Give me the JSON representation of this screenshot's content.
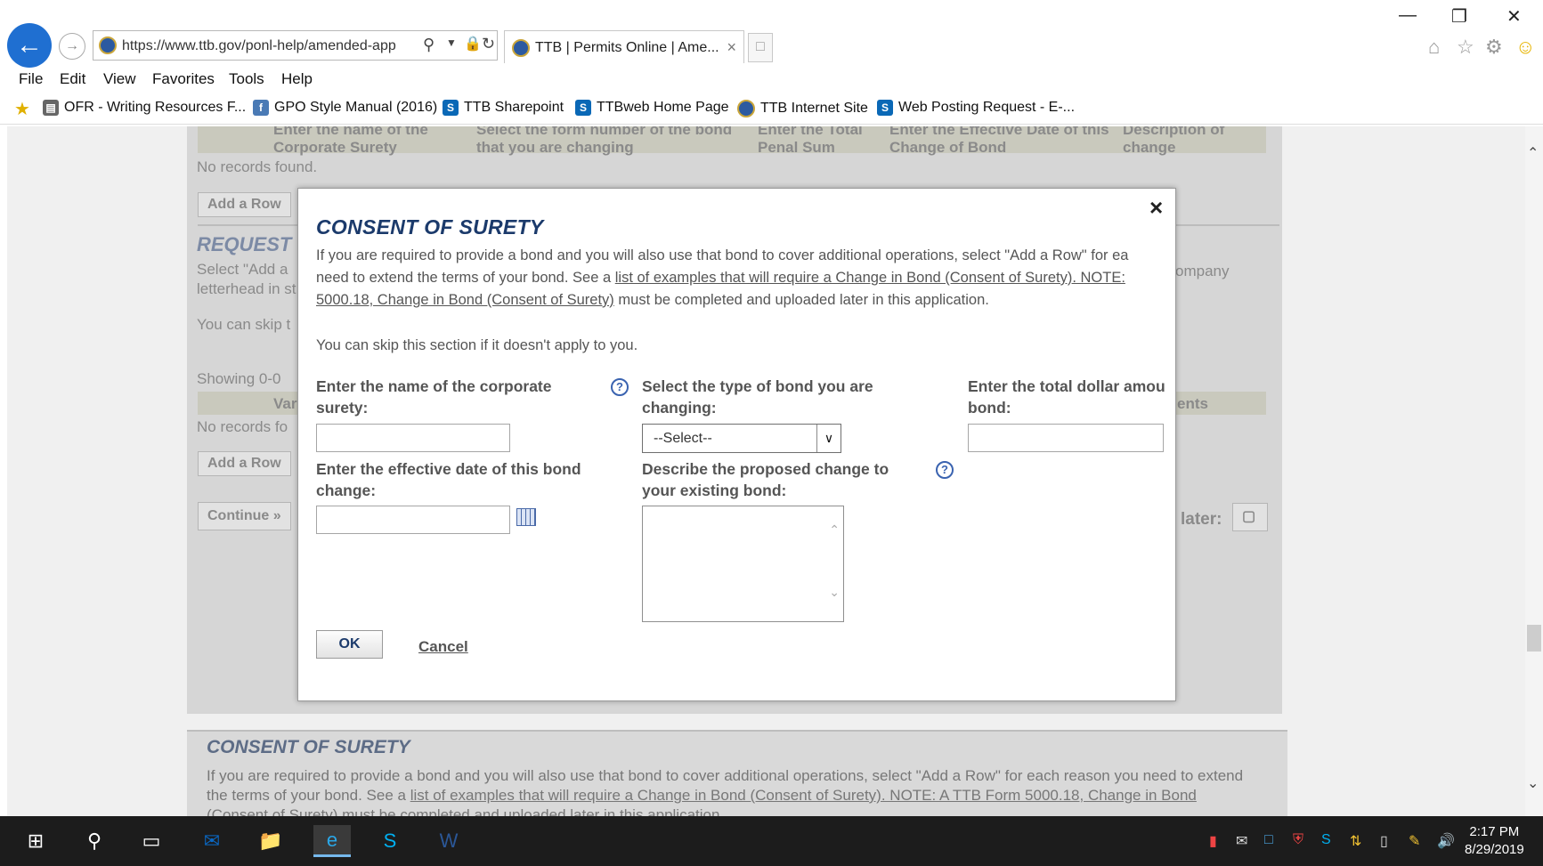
{
  "browser": {
    "url": "https://www.ttb.gov/ponl-help/amended-app",
    "tab_title": "TTB | Permits Online | Ame...",
    "menu": [
      "File",
      "Edit",
      "View",
      "Favorites",
      "Tools",
      "Help"
    ],
    "favorites": [
      "OFR - Writing Resources F...",
      "GPO Style Manual (2016)",
      "TTB Sharepoint",
      "TTBweb Home Page",
      "TTB Internet Site",
      "Web Posting Request - E-..."
    ]
  },
  "background": {
    "table_headers": [
      "Enter the name of the",
      "Corporate Surety",
      "Select the form number of the bond",
      "that you are changing",
      "Enter the Total",
      "Penal Sum",
      "Enter the Effective Date of this",
      "Change of Bond",
      "Description of",
      "change"
    ],
    "no_records": "No records found.",
    "no_records_truncated": "No records fo",
    "add_row": "Add a Row",
    "request_heading": "REQUEST",
    "select_add": "Select \"Add a",
    "letterhead": "letterhead in st",
    "company": "ompany",
    "you_can_skip": "You can skip t",
    "showing": "Showing 0-0",
    "var": "Var",
    "ents": "ents",
    "continue": "Continue »",
    "later": "later:",
    "section2_title": "CONSENT OF SURETY",
    "section2_line1": "If you are required to provide a bond and you will also use that bond to cover additional operations, select \"Add a Row\" for each reason you need to extend",
    "section2_line2_pre": "the terms of your bond. See a ",
    "section2_link": "list of examples that will require a Change in Bond (Consent of Surety). NOTE: A TTB Form 5000.18, Change in Bond",
    "section2_line3": "(Consent of Surety) must be completed and uploaded later in this application."
  },
  "dialog": {
    "title": "CONSENT OF SURETY",
    "intro_pre": "If you are required to provide a bond and you will also use that bond to cover additional operations, select \"Add a Row\" for ea",
    "intro_line2_pre": "need to extend the terms of your bond. See a ",
    "intro_link": "list of examples that will require a Change in Bond (Consent of Surety). NOTE:",
    "intro_link2": "5000.18, Change in Bond (Consent of Surety)",
    "intro_post": " must be completed and uploaded later in this application.",
    "skip_text": "You can skip this section if it doesn't apply to you.",
    "surety_label_1": "Enter the name of the corporate",
    "surety_label_2": "surety:",
    "bondtype_label_1": "Select the type of bond you are",
    "bondtype_label_2": "changing:",
    "bondtype_value": "--Select--",
    "amount_label_1": "Enter the total dollar amou",
    "amount_label_2": "bond:",
    "date_label_1": "Enter the effective date of this bond",
    "date_label_2": "change:",
    "change_label_1": "Describe the proposed change to",
    "change_label_2": "your existing bond:",
    "ok": "OK",
    "cancel": "Cancel",
    "close": "×"
  },
  "taskbar": {
    "time": "2:17 PM",
    "date": "8/29/2019"
  }
}
